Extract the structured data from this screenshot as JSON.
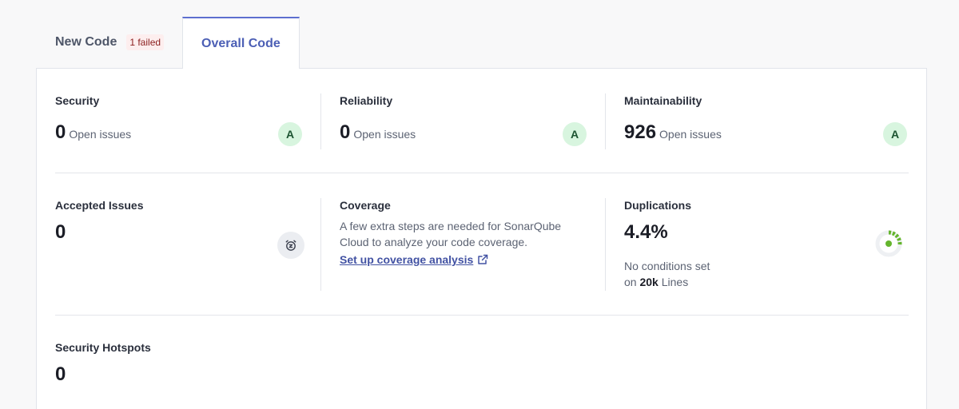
{
  "tabs": {
    "new_code": {
      "label": "New Code",
      "badge": "1 failed"
    },
    "overall_code": {
      "label": "Overall Code"
    }
  },
  "security": {
    "title": "Security",
    "value": "0",
    "suffix": "Open issues",
    "rating": "A"
  },
  "reliability": {
    "title": "Reliability",
    "value": "0",
    "suffix": "Open issues",
    "rating": "A"
  },
  "maintainability": {
    "title": "Maintainability",
    "value": "926",
    "suffix": "Open issues",
    "rating": "A"
  },
  "accepted_issues": {
    "title": "Accepted Issues",
    "value": "0"
  },
  "coverage": {
    "title": "Coverage",
    "description": "A few extra steps are needed for SonarQube Cloud to analyze your code coverage.",
    "link_label": "Set up coverage analysis"
  },
  "duplications": {
    "title": "Duplications",
    "value": "4.4%",
    "conditions": "No conditions set",
    "on_prefix": "on",
    "lines_count": "20k",
    "lines_suffix": "Lines",
    "fraction": 0.044
  },
  "security_hotspots": {
    "title": "Security Hotspots",
    "value": "0"
  },
  "colors": {
    "accent": "#5d6fcf",
    "rating_bg": "#d8f5df",
    "rating_text": "#1c5431",
    "duplication_green": "#64b52d",
    "failed_text": "#8b1e1e"
  },
  "icons": {
    "accepted": "alarm-clock-icon",
    "external_link": "external-link-icon",
    "duplication_gauge": "duplication-gauge-icon"
  }
}
